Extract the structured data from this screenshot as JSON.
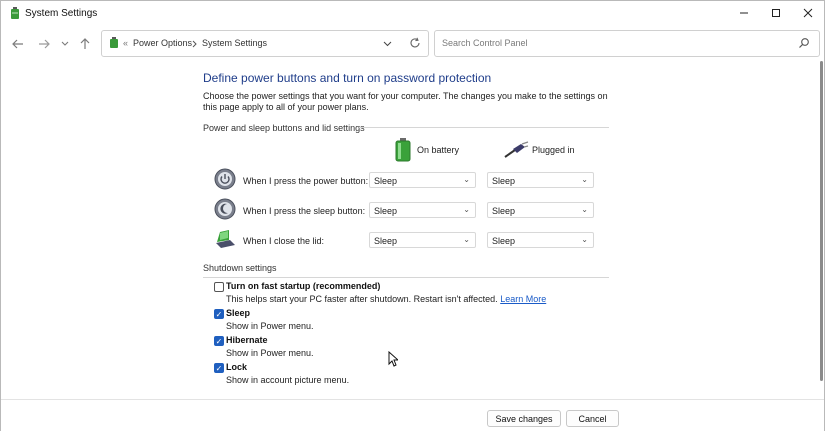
{
  "window": {
    "title": "System Settings"
  },
  "nav": {
    "breadcrumb": [
      "Power Options",
      "System Settings"
    ],
    "breadcrumb_overflow": "«",
    "search_placeholder": "Search Control Panel"
  },
  "main": {
    "heading": "Define power buttons and turn on password protection",
    "description": "Choose the power settings that you want for your computer. The changes you make to the settings on this page apply to all of your power plans.",
    "buttons_section": {
      "title": "Power and sleep buttons and lid settings",
      "columns": {
        "battery": "On battery",
        "plugged": "Plugged in"
      },
      "rows": [
        {
          "label": "When I press the power button:",
          "battery": "Sleep",
          "plugged": "Sleep",
          "icon": "power-button-icon"
        },
        {
          "label": "When I press the sleep button:",
          "battery": "Sleep",
          "plugged": "Sleep",
          "icon": "sleep-button-icon"
        },
        {
          "label": "When I close the lid:",
          "battery": "Sleep",
          "plugged": "Sleep",
          "icon": "laptop-lid-icon"
        }
      ]
    },
    "shutdown_section": {
      "title": "Shutdown settings",
      "items": [
        {
          "label": "Turn on fast startup (recommended)",
          "hint": "This helps start your PC faster after shutdown. Restart isn't affected.",
          "link": "Learn More",
          "checked": false
        },
        {
          "label": "Sleep",
          "hint": "Show in Power menu.",
          "checked": true
        },
        {
          "label": "Hibernate",
          "hint": "Show in Power menu.",
          "checked": true
        },
        {
          "label": "Lock",
          "hint": "Show in account picture menu.",
          "checked": true
        }
      ]
    }
  },
  "footer": {
    "save": "Save changes",
    "cancel": "Cancel"
  },
  "colors": {
    "heading": "#1f3d8a",
    "checkbox": "#1f5fbf",
    "link": "#1a5bc8"
  }
}
